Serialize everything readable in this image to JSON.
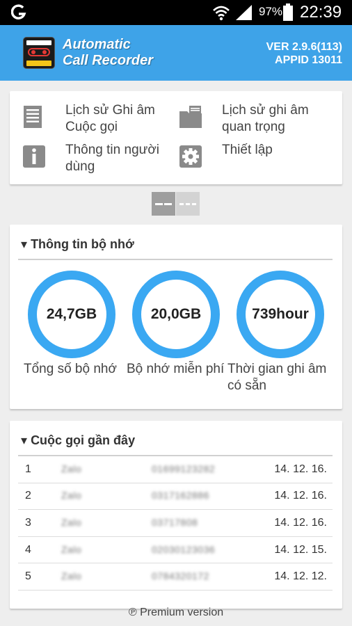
{
  "status_bar": {
    "battery_percent": "97%",
    "time": "22:39"
  },
  "header": {
    "title_line1": "Automatic",
    "title_line2": "Call Recorder",
    "logo_text_top": "Automatic",
    "logo_text_bottom": "Call Recorder",
    "version": "VER 2.9.6(113)",
    "appid": "APPID 13011",
    "color": "#3ea3e8"
  },
  "menu": {
    "items": [
      {
        "label": "Lịch sử Ghi âm Cuộc gọi",
        "icon": "list-icon"
      },
      {
        "label": "Lịch sử ghi âm quan trọng",
        "icon": "folder-icon"
      },
      {
        "label": "Thông tin người dùng",
        "icon": "info-icon"
      },
      {
        "label": "Thiết lập",
        "icon": "gear-icon"
      }
    ]
  },
  "memory": {
    "title": "Thông tin bộ nhớ",
    "gauges": [
      {
        "value": "24,7GB",
        "label": "Tổng số bộ nhớ"
      },
      {
        "value": "20,0GB",
        "label": "Bộ nhớ miễn phí"
      },
      {
        "value": "739hour",
        "label_line1": "Thời gian ghi âm",
        "label_line2": "có sẵn"
      }
    ],
    "gauge_color": "#3aa8f2"
  },
  "calls": {
    "title": "Cuộc gọi gần đây",
    "rows": [
      {
        "index": "1",
        "name": "Zalo",
        "phone": "01699123282",
        "date": "14. 12. 16."
      },
      {
        "index": "2",
        "name": "Zalo",
        "phone": "0317162886",
        "date": "14. 12. 16."
      },
      {
        "index": "3",
        "name": "Zalo",
        "phone": "03717808",
        "date": "14. 12. 16."
      },
      {
        "index": "4",
        "name": "Zalo",
        "phone": "02030123036",
        "date": "14. 12. 15."
      },
      {
        "index": "5",
        "name": "Zalo",
        "phone": "0784320172",
        "date": "14. 12. 12."
      }
    ]
  },
  "footer": {
    "premium_label": "℗ Premium version"
  }
}
